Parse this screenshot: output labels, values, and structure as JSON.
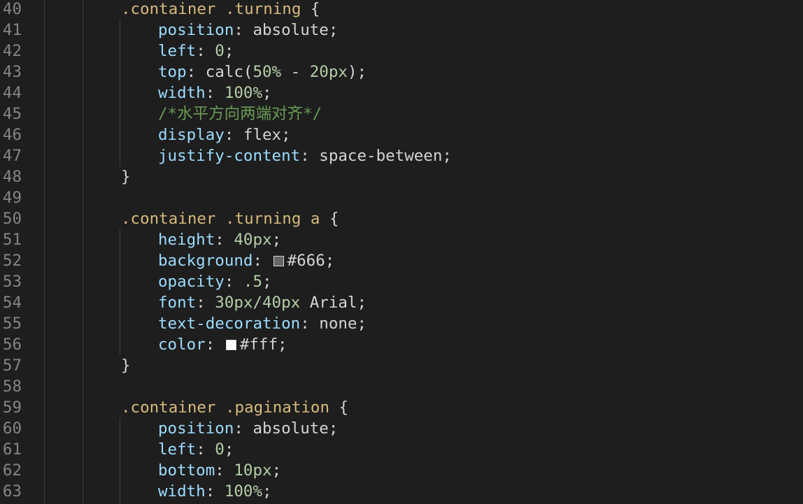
{
  "editor": {
    "lines": [
      {
        "num": "40",
        "indent": 1,
        "tokens": [
          {
            "t": ".container .turning",
            "c": "selector"
          },
          {
            "t": " {",
            "c": "text"
          }
        ]
      },
      {
        "num": "41",
        "indent": 2,
        "tokens": [
          {
            "t": "position",
            "c": "prop"
          },
          {
            "t": ": absolute;",
            "c": "text"
          }
        ]
      },
      {
        "num": "42",
        "indent": 2,
        "tokens": [
          {
            "t": "left",
            "c": "prop"
          },
          {
            "t": ": ",
            "c": "text"
          },
          {
            "t": "0",
            "c": "num"
          },
          {
            "t": ";",
            "c": "text"
          }
        ]
      },
      {
        "num": "43",
        "indent": 2,
        "tokens": [
          {
            "t": "top",
            "c": "prop"
          },
          {
            "t": ": calc(",
            "c": "text"
          },
          {
            "t": "50%",
            "c": "num"
          },
          {
            "t": " - ",
            "c": "text"
          },
          {
            "t": "20px",
            "c": "num"
          },
          {
            "t": ");",
            "c": "text"
          }
        ]
      },
      {
        "num": "44",
        "indent": 2,
        "tokens": [
          {
            "t": "width",
            "c": "prop"
          },
          {
            "t": ": ",
            "c": "text"
          },
          {
            "t": "100%",
            "c": "num"
          },
          {
            "t": ";",
            "c": "text"
          }
        ]
      },
      {
        "num": "45",
        "indent": 2,
        "tokens": [
          {
            "t": "/*水平方向两端对齐*/",
            "c": "comment"
          }
        ]
      },
      {
        "num": "46",
        "indent": 2,
        "tokens": [
          {
            "t": "display",
            "c": "prop"
          },
          {
            "t": ": flex;",
            "c": "text"
          }
        ]
      },
      {
        "num": "47",
        "indent": 2,
        "tokens": [
          {
            "t": "justify-content",
            "c": "prop"
          },
          {
            "t": ": space-between;",
            "c": "text"
          }
        ]
      },
      {
        "num": "48",
        "indent": 1,
        "tokens": [
          {
            "t": "}",
            "c": "text"
          }
        ]
      },
      {
        "num": "49",
        "indent": 1,
        "tokens": []
      },
      {
        "num": "50",
        "indent": 1,
        "tokens": [
          {
            "t": ".container .turning a",
            "c": "selector"
          },
          {
            "t": " {",
            "c": "text"
          }
        ]
      },
      {
        "num": "51",
        "indent": 2,
        "tokens": [
          {
            "t": "height",
            "c": "prop"
          },
          {
            "t": ": ",
            "c": "text"
          },
          {
            "t": "40px",
            "c": "num"
          },
          {
            "t": ";",
            "c": "text"
          }
        ]
      },
      {
        "num": "52",
        "indent": 2,
        "tokens": [
          {
            "t": "background",
            "c": "prop"
          },
          {
            "t": ": ",
            "c": "text"
          },
          {
            "swatch": "#666666"
          },
          {
            "t": "#666;",
            "c": "text"
          }
        ]
      },
      {
        "num": "53",
        "indent": 2,
        "tokens": [
          {
            "t": "opacity",
            "c": "prop"
          },
          {
            "t": ": ",
            "c": "text"
          },
          {
            "t": ".5",
            "c": "num"
          },
          {
            "t": ";",
            "c": "text"
          }
        ]
      },
      {
        "num": "54",
        "indent": 2,
        "tokens": [
          {
            "t": "font",
            "c": "prop"
          },
          {
            "t": ": ",
            "c": "text"
          },
          {
            "t": "30px/40px",
            "c": "num"
          },
          {
            "t": " Arial;",
            "c": "text"
          }
        ]
      },
      {
        "num": "55",
        "indent": 2,
        "tokens": [
          {
            "t": "text-decoration",
            "c": "prop"
          },
          {
            "t": ": none;",
            "c": "text"
          }
        ]
      },
      {
        "num": "56",
        "indent": 2,
        "tokens": [
          {
            "t": "color",
            "c": "prop"
          },
          {
            "t": ": ",
            "c": "text"
          },
          {
            "swatch": "#ffffff"
          },
          {
            "t": "#fff;",
            "c": "text"
          }
        ]
      },
      {
        "num": "57",
        "indent": 1,
        "tokens": [
          {
            "t": "}",
            "c": "text"
          }
        ]
      },
      {
        "num": "58",
        "indent": 1,
        "tokens": []
      },
      {
        "num": "59",
        "indent": 1,
        "tokens": [
          {
            "t": ".container .pagination",
            "c": "selector"
          },
          {
            "t": " {",
            "c": "text"
          }
        ]
      },
      {
        "num": "60",
        "indent": 2,
        "tokens": [
          {
            "t": "position",
            "c": "prop"
          },
          {
            "t": ": absolute;",
            "c": "text"
          }
        ]
      },
      {
        "num": "61",
        "indent": 2,
        "tokens": [
          {
            "t": "left",
            "c": "prop"
          },
          {
            "t": ": ",
            "c": "text"
          },
          {
            "t": "0",
            "c": "num"
          },
          {
            "t": ";",
            "c": "text"
          }
        ]
      },
      {
        "num": "62",
        "indent": 2,
        "tokens": [
          {
            "t": "bottom",
            "c": "prop"
          },
          {
            "t": ": ",
            "c": "text"
          },
          {
            "t": "10px",
            "c": "num"
          },
          {
            "t": ";",
            "c": "text"
          }
        ]
      },
      {
        "num": "63",
        "indent": 2,
        "tokens": [
          {
            "t": "width",
            "c": "prop"
          },
          {
            "t": ": ",
            "c": "text"
          },
          {
            "t": "100%",
            "c": "num"
          },
          {
            "t": ";",
            "c": "text"
          }
        ]
      }
    ]
  },
  "theme": {
    "background": "#1e1e1e",
    "line_number": "#858585",
    "selector": "#d7ba7d",
    "property": "#9cdcfe",
    "number": "#b5cea8",
    "comment": "#6a9955",
    "text": "#d4d4d4"
  }
}
